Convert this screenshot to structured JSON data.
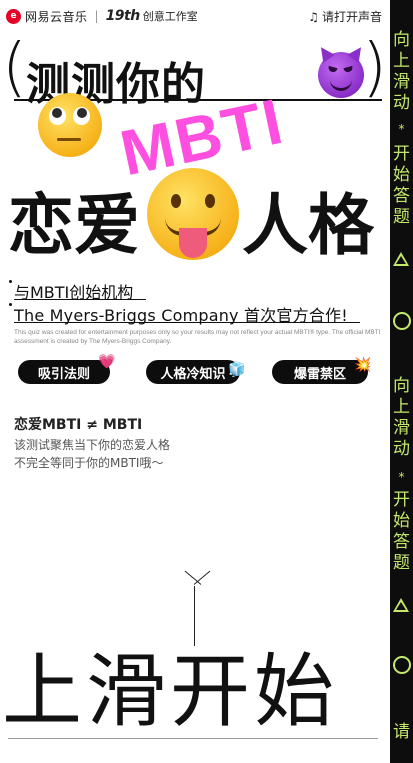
{
  "topbar": {
    "logo_glyph": "e",
    "brand": "网易云音乐",
    "separator": "|",
    "brand19": "19th",
    "studio": "创意工作室",
    "sound_icon": "music-note-icon",
    "sound_label": "请打开声音"
  },
  "hero": {
    "title_line1": "测测你的",
    "bracket_open": "(",
    "bracket_close": ")",
    "highlight": "MBTI",
    "title_line2": "恋爱人格",
    "title_line2_left": "恋爱",
    "title_line2_right": "人格",
    "highlight_color": "#ff4fe0"
  },
  "subtitle": {
    "line1": "与MBTI创始机构",
    "line2": "The Myers-Briggs Company 首次官方合作!",
    "disclaimer": "This quiz was created for entertainment purposes only so your results may not reflect your actual MBTI® type. The official MBTI assessment is created by The Myers-Briggs Company."
  },
  "pills": [
    {
      "label": "吸引法则",
      "icon": "sparkling-heart-icon",
      "glyph": "💗"
    },
    {
      "label": "人格冷知识",
      "icon": "ice-cube-icon",
      "glyph": "🧊"
    },
    {
      "label": "爆雷禁区",
      "icon": "collision-icon",
      "glyph": "💥"
    }
  ],
  "section": {
    "title": "恋爱MBTI ≠ MBTI",
    "desc_line1": "该测试聚焦当下你的恋爱人格",
    "desc_line2": "不完全等同于你的MBTI哦～"
  },
  "cta": {
    "swipe_text": "上滑开始"
  },
  "side_strip": {
    "group1": "向上滑动",
    "star": "*",
    "group2": "开始答题",
    "group3": "向上滑动",
    "group4": "开始答题",
    "group5": "请",
    "accent_color": "#c4e86a"
  }
}
